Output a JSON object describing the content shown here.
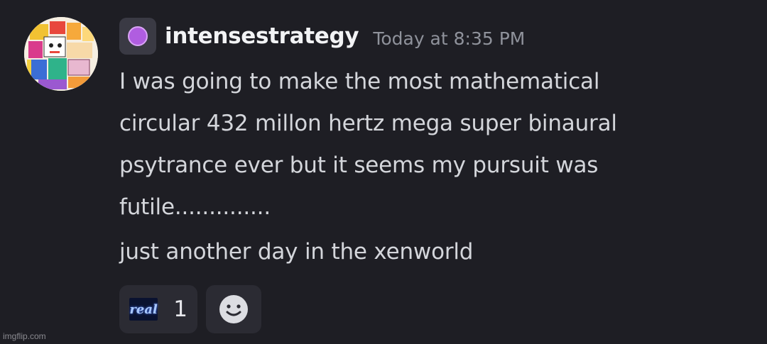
{
  "message": {
    "author": "intensestrategy",
    "timestamp": "Today at 8:35 PM",
    "role_icon": "purple-circle-icon",
    "avatar": "pixel-art-avatar",
    "lines": [
      "I was going to make the most mathematical",
      "circular 432 millon hertz mega super binaural",
      "psytrance ever but it seems my pursuit was",
      "futile.............."
    ],
    "second_paragraph": "just another day in the xenworld"
  },
  "reactions": [
    {
      "emoji_label": "real",
      "emoji_name": "real-emoji",
      "count": "1"
    }
  ],
  "add_reaction_icon": "smile-icon",
  "watermark": "imgflip.com",
  "colors": {
    "background": "#1e1e24",
    "username": "#f2f3f5",
    "text": "#d4d6db",
    "timestamp": "#8f929b",
    "reaction_bg": "#2b2b33",
    "role_dot": "#b05de0"
  }
}
